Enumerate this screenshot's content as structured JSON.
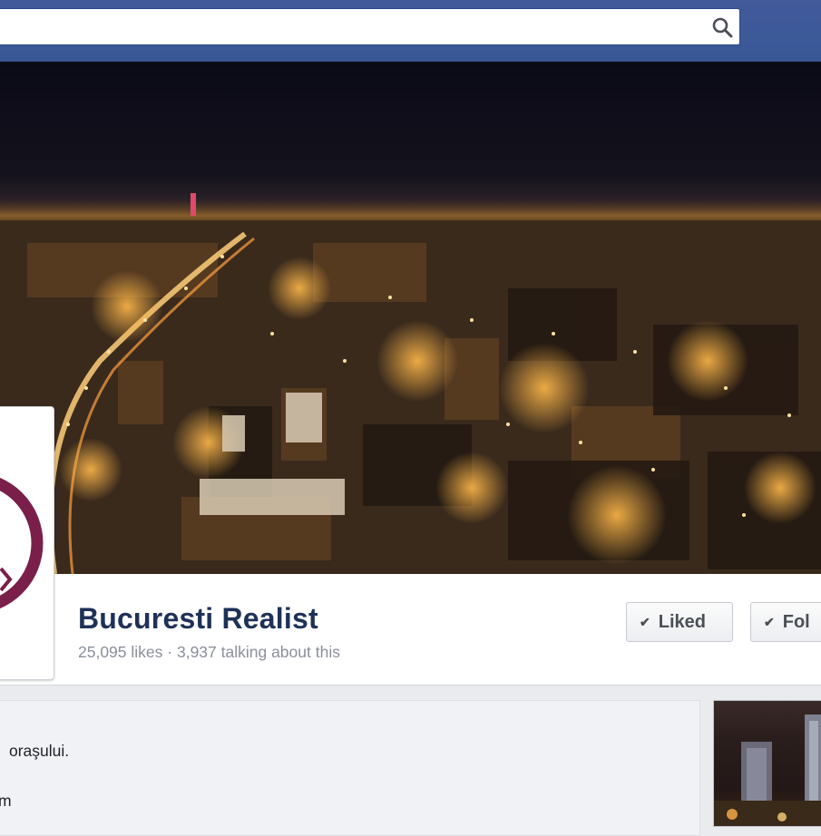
{
  "search": {
    "value": "",
    "placeholder": ""
  },
  "page": {
    "name": "Bucuresti Realist",
    "likes": "25,095 likes",
    "separator": " · ",
    "talking": "3,937 talking about this"
  },
  "buttons": {
    "liked": "Liked",
    "follow": "Fol"
  },
  "about": {
    "line1": "oraşului.",
    "line2": "m"
  },
  "colors": {
    "topbar": "#3b5998",
    "page_name": "#1f3157",
    "logo_ring": "#7a1f49"
  },
  "icons": {
    "search": "magnifier",
    "check": "checkmark"
  }
}
